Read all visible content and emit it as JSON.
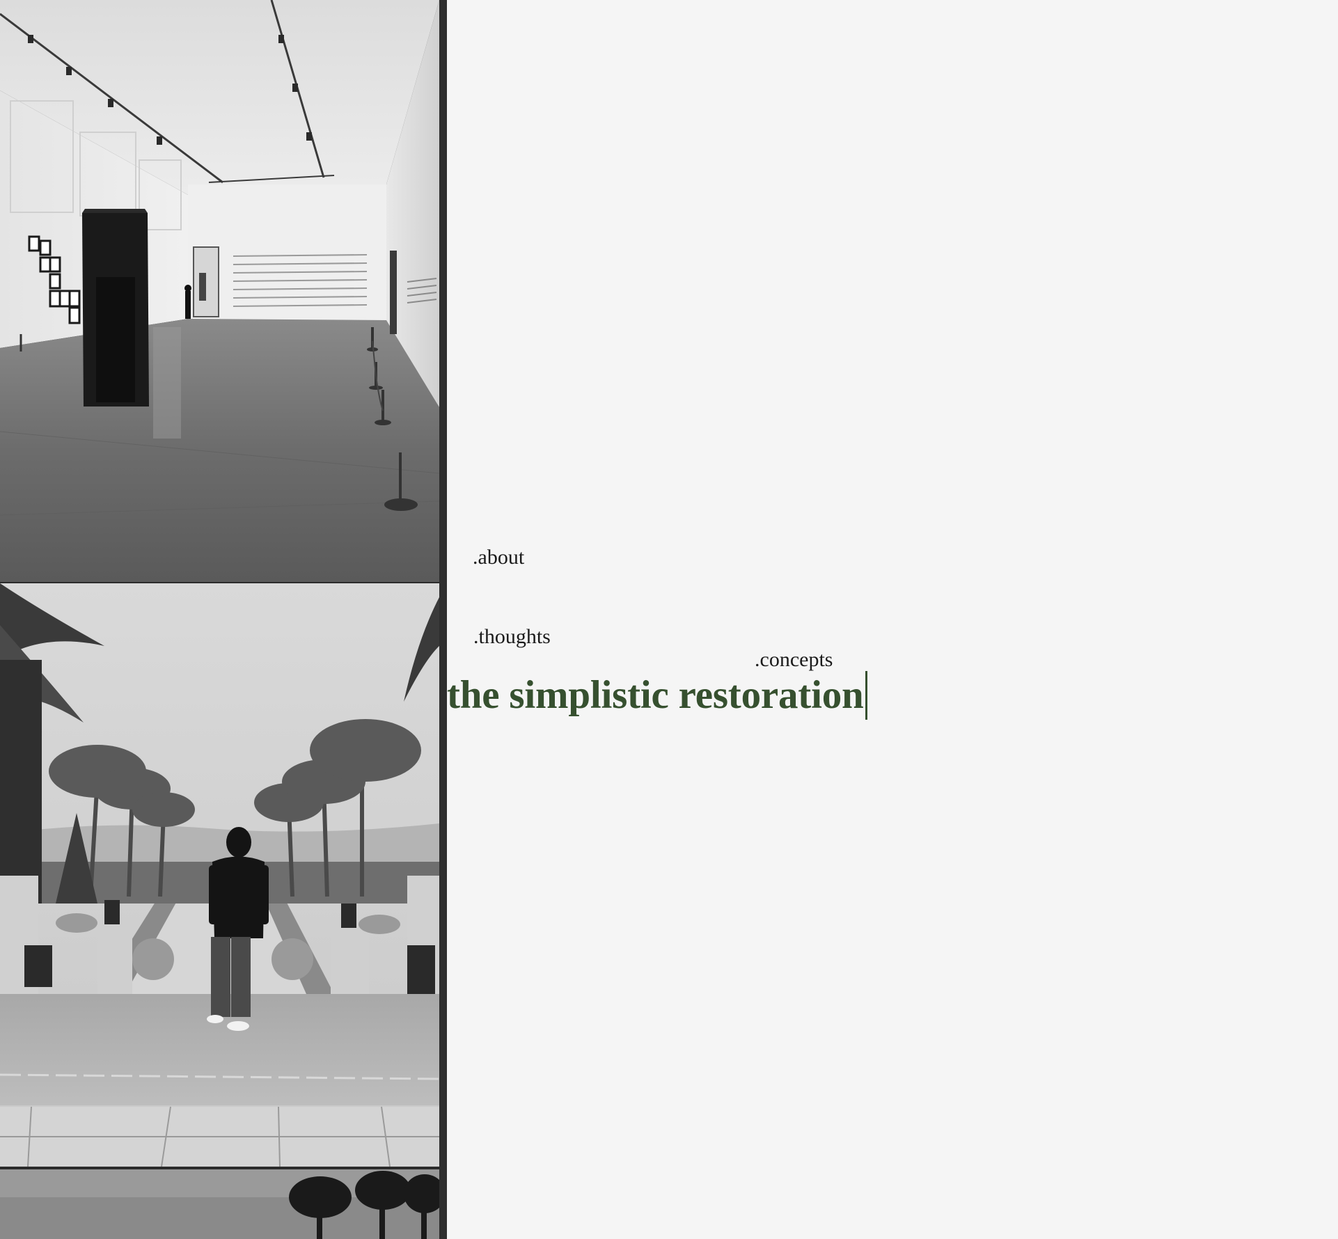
{
  "nav": {
    "about": ".about",
    "thoughts": ".thoughts",
    "concepts": ".concepts"
  },
  "hero": {
    "title": "the simplistic restoration"
  },
  "gallery": {
    "photos": [
      {
        "subject": "art-gallery-interior"
      },
      {
        "subject": "person-overlooking-palm-garden"
      },
      {
        "subject": "palm-trees-under-grey-sky"
      }
    ]
  },
  "colors": {
    "background": "#f5f5f5",
    "title": "#36502f",
    "nav_text": "#1b1b1b",
    "divider": "#2e2e2e"
  }
}
